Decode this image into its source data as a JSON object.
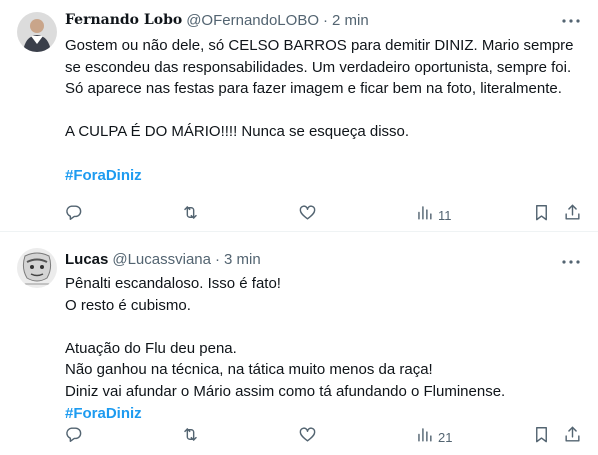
{
  "tweets": [
    {
      "author_name": "Fernando Lobo",
      "handle": "@OFernandoLOBO",
      "separator": "·",
      "time": "2 min",
      "paragraphs": [
        [
          "Gostem ou não dele, só CELSO BARROS para demitir DINIZ. Mario sempre se escondeu das responsabilidades. Um verdadeiro oportunista, sempre foi. Só aparece nas festas para fazer imagem e ficar bem na foto, literalmente."
        ],
        [
          "A CULPA É DO MÁRIO!!!! Nunca se esqueça disso."
        ]
      ],
      "hashtag": "#ForaDiniz",
      "views": "11"
    },
    {
      "author_name": "Lucas",
      "handle": "@Lucassviana",
      "separator": "·",
      "time": "3 min",
      "paragraphs": [
        [
          "Pênalti escandaloso. Isso é fato!",
          "O resto é cubismo."
        ],
        [
          "Atuação do Flu deu pena.",
          "Não ganhou na técnica, na tática muito menos da raça!",
          "Diniz vai afundar o Mário assim como tá afundando o Fluminense."
        ]
      ],
      "hashtag": "#ForaDiniz",
      "views": "21"
    }
  ],
  "icons": [
    "reply-icon",
    "retweet-icon",
    "like-icon",
    "views-icon",
    "bookmark-icon",
    "share-icon",
    "more-icon"
  ],
  "colors": {
    "hashtag": "#1d9bf0",
    "secondary_text": "#536471",
    "primary_text": "#0f1419",
    "divider": "#eff3f4"
  }
}
